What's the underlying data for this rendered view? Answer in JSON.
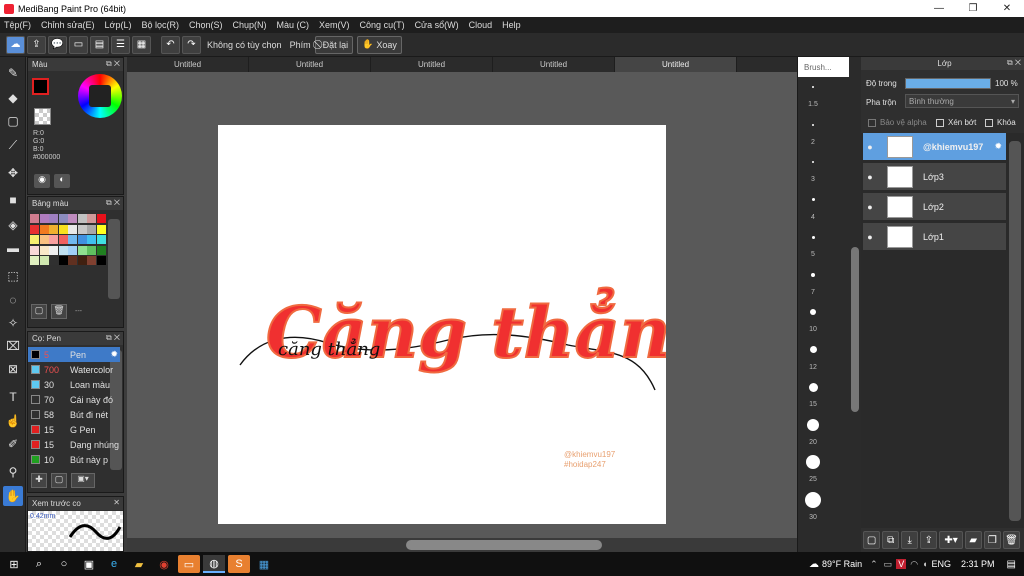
{
  "window": {
    "title": "MediBang Paint Pro (64bit)"
  },
  "menu": [
    "Tệp(F)",
    "Chỉnh sửa(E)",
    "Lớp(L)",
    "Bộ lọc(R)",
    "Chọn(S)",
    "Chụp(N)",
    "Màu (C)",
    "Xem(V)",
    "Công cụ(T)",
    "Cửa sổ(W)",
    "Cloud",
    "Help"
  ],
  "toolbar": {
    "no_option": "Không có tùy chọn",
    "keys": "Phím",
    "reset": "Đặt lại",
    "rotate": "Xoay"
  },
  "color_panel": {
    "title": "Màu",
    "r": "R:0",
    "g": "G:0",
    "b": "B:0",
    "hex": "#000000"
  },
  "palette_panel": {
    "title": "Bảng màu",
    "dash": "---",
    "colors": [
      "#cf7c8e",
      "#b07cbf",
      "#9e7fc0",
      "#8c8cbf",
      "#bf8cbf",
      "#c0c0c0",
      "#d09898",
      "#e8101a",
      "#e83030",
      "#f07a20",
      "#f0b030",
      "#f8e020",
      "#e8e8e8",
      "#c8c8c8",
      "#a8a8a8",
      "#ffff20",
      "#f8f070",
      "#f8c080",
      "#f8a0a0",
      "#f06060",
      "#70b8f0",
      "#4090e0",
      "#40c0f0",
      "#40e0e0",
      "#f8d8d8",
      "#f8e8c8",
      "#f0f0f0",
      "#c0e0f0",
      "#a0d0f8",
      "#90e090",
      "#60c060",
      "#208020",
      "#e0f0c0",
      "#d0e8b0",
      "#303030",
      "#000000",
      "#603020",
      "#402010",
      "#804030",
      "#000000"
    ]
  },
  "brush_panel": {
    "title": "Cọ: Pen",
    "items": [
      {
        "size": "5",
        "name": "Pen",
        "color": "#000000"
      },
      {
        "size": "700",
        "name": "Watercolor",
        "color": "#5ec8f0"
      },
      {
        "size": "30",
        "name": "Loan màu",
        "color": "#5ec8f0"
      },
      {
        "size": "70",
        "name": "Cái này đó",
        "color": "#303030"
      },
      {
        "size": "58",
        "name": "Bút đi nét",
        "color": "#303030"
      },
      {
        "size": "15",
        "name": "G Pen",
        "color": "#e02020"
      },
      {
        "size": "15",
        "name": "Dạng nhúng",
        "color": "#e02020"
      },
      {
        "size": "10",
        "name": "Bút này p",
        "color": "#20a020"
      }
    ]
  },
  "preview_panel": {
    "title": "Xem trước co",
    "size": "0.42mm"
  },
  "tabs": [
    "Untitled",
    "Untitled",
    "Untitled",
    "Untitled",
    "Untitled"
  ],
  "canvas": {
    "main_text": "Căng thẳng",
    "sub_text": "căng thẳng",
    "credit1": "@khiemvu197",
    "credit2": "#hoidap247"
  },
  "brush_sizes": {
    "title": "Brush...",
    "labels": [
      "1.5",
      "2",
      "3",
      "4",
      "5",
      "7",
      "10",
      "12",
      "15",
      "20",
      "25",
      "30"
    ]
  },
  "layer_panel": {
    "title": "Lớp",
    "opacity_label": "Độ trong",
    "opacity_value": "100 %",
    "opacity_fraction": 1.0,
    "blend_label": "Pha trộn",
    "blend_value": "Bình thường",
    "protect_alpha": "Bảo vệ alpha",
    "clipping": "Xén bớt",
    "lock": "Khóa",
    "layers": [
      {
        "name": "@khiemvu197",
        "selected": true
      },
      {
        "name": "Lớp3",
        "selected": false
      },
      {
        "name": "Lớp2",
        "selected": false
      },
      {
        "name": "Lớp1",
        "selected": false
      }
    ]
  },
  "taskbar": {
    "weather": "89°F Rain",
    "lang": "ENG",
    "time": "2:31 PM"
  }
}
